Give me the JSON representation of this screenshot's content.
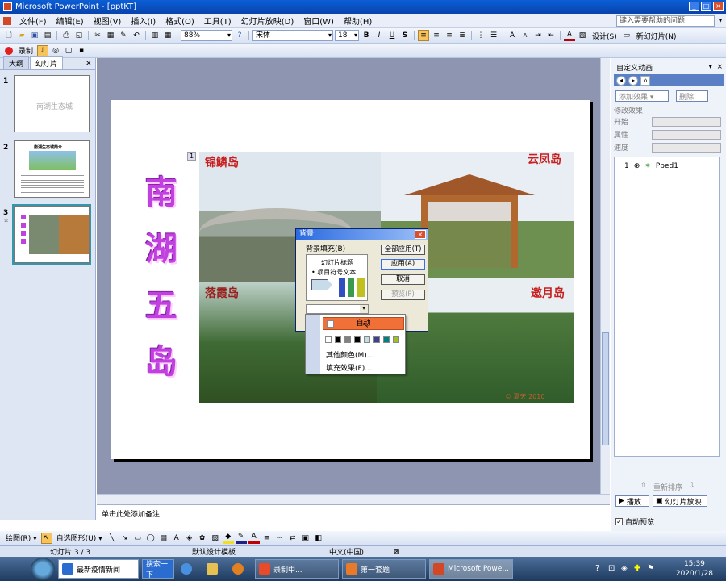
{
  "window": {
    "title": "Microsoft PowerPoint - [pptKT]",
    "min": "_",
    "max": "□",
    "close": "×"
  },
  "menu": {
    "items": [
      "文件(F)",
      "编辑(E)",
      "视图(V)",
      "插入(I)",
      "格式(O)",
      "工具(T)",
      "幻灯片放映(D)",
      "窗口(W)",
      "帮助(H)"
    ],
    "help_placeholder": "键入需要帮助的问题",
    "help_arrow": "▾"
  },
  "toolbar1": {
    "zoom": "88%",
    "font": "宋体",
    "font_size": "18",
    "bold": "B",
    "italic": "I",
    "underline": "U",
    "shadow": "S",
    "design_label": "设计(S)",
    "new_slide_label": "新幻灯片(N)"
  },
  "toolbar2": {
    "record_label": "录制"
  },
  "left_panel": {
    "tabs": [
      "大纲",
      "幻灯片"
    ],
    "close": "×",
    "slide_numbers": [
      "1",
      "2",
      "3"
    ],
    "slide1_title": "南湖生态城",
    "slide2_title": "南湖生态城简介",
    "slide3_icon": "☆"
  },
  "slide": {
    "vertical_title": [
      "南",
      "湖",
      "五",
      "岛"
    ],
    "photo_index": "1",
    "labels": {
      "top_left": "锦鳞岛",
      "top_right": "云凤岛",
      "bottom_left": "落霞岛",
      "bottom_right": "邀月岛"
    },
    "watermark": "© 夏天 2010"
  },
  "notes": {
    "placeholder": "单击此处添加备注"
  },
  "task_pane": {
    "title": "自定义动画",
    "add_effect": "添加效果 ▾",
    "delete": "删除",
    "modify_label": "修改效果",
    "rows": [
      "开始",
      "属性",
      "速度"
    ],
    "list_item_num": "1",
    "list_item_name": "Pbed1",
    "reorder_label": "重新排序",
    "play_label": "播放",
    "show_label": "幻灯片放映",
    "autopreview_label": "自动预览",
    "autopreview_checked": true
  },
  "dialog": {
    "title": "背景",
    "close": "×",
    "group_label": "背景填充(B)",
    "preview_title": "幻灯片标题",
    "preview_bullet": "• 项目符号文本",
    "buttons": [
      "全部应用(T)",
      "应用(A)",
      "取消",
      "预览(P)"
    ]
  },
  "color_popup": {
    "auto_label": "自动",
    "more_colors": "其他颜色(M)...",
    "fill_effects": "填充效果(F)...",
    "swatches": [
      "#ffffff",
      "#000000",
      "#808080",
      "#000000",
      "#c0e0e0",
      "#404090",
      "#008080",
      "#a0c020"
    ]
  },
  "drawbar": {
    "draw_label": "绘图(R) ▾",
    "autoshapes_label": "自选图形(U) ▾"
  },
  "status": {
    "slide": "幻灯片 3 / 3",
    "template": "默认设计模板",
    "language": "中文(中国)"
  },
  "taskbar": {
    "tasks": [
      "最新疫情新闻",
      "搜索一下",
      "录制中...",
      "第一套题",
      "Microsoft Powe..."
    ],
    "time": "15:39",
    "date": "2020/1/28"
  }
}
